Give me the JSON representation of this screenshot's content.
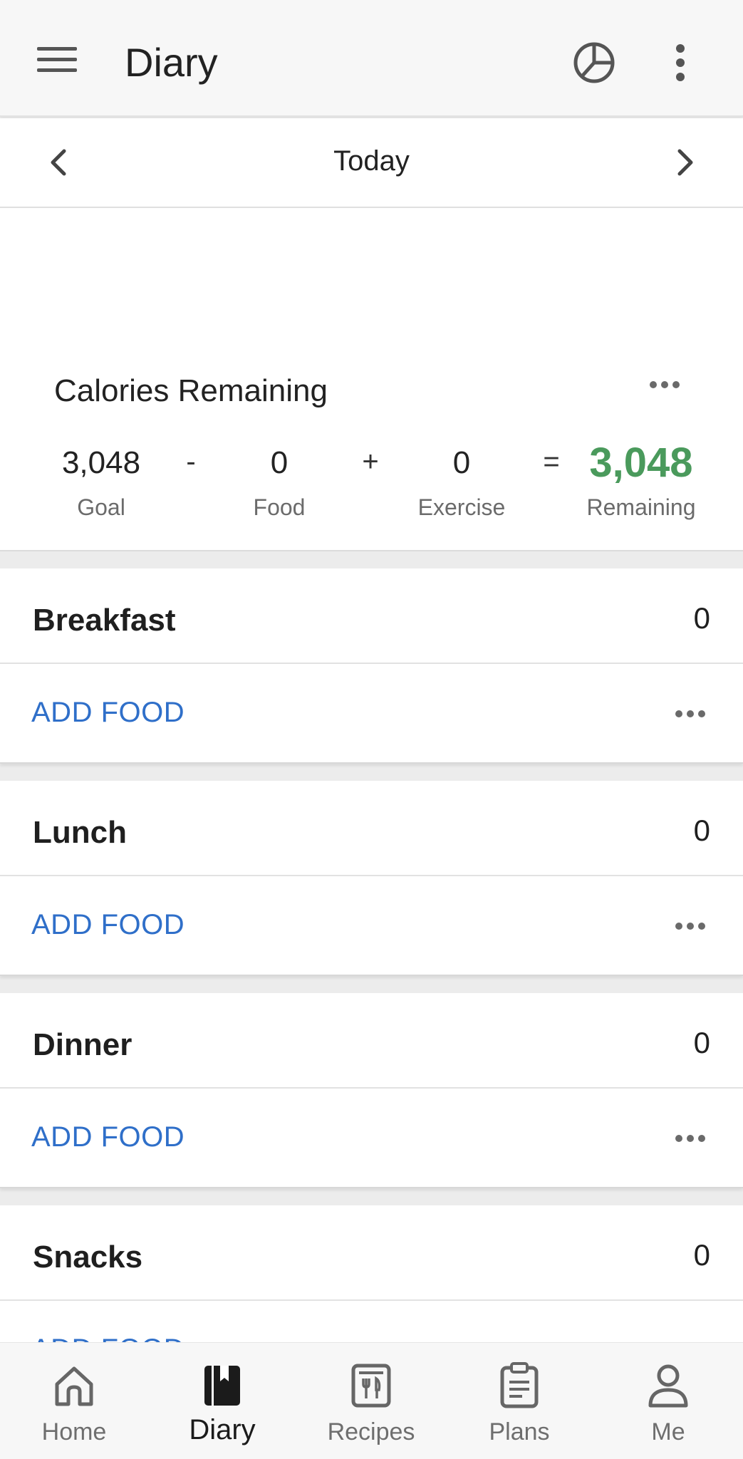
{
  "app_bar": {
    "title": "Diary",
    "menu_icon": "hamburger-menu-icon",
    "chart_icon": "pie-chart-icon",
    "more_icon": "vertical-dots-icon"
  },
  "date_nav": {
    "label": "Today",
    "prev_icon": "chevron-left-icon",
    "next_icon": "chevron-right-icon"
  },
  "calories": {
    "title": "Calories Remaining",
    "goal_value": "3,048",
    "goal_label": "Goal",
    "minus": "-",
    "food_value": "0",
    "food_label": "Food",
    "plus": "+",
    "exercise_value": "0",
    "exercise_label": "Exercise",
    "equals": "=",
    "remaining_value": "3,048",
    "remaining_label": "Remaining",
    "remaining_color": "#4a9a5c"
  },
  "meals": [
    {
      "name": "Breakfast",
      "calories": "0",
      "add_label": "ADD FOOD"
    },
    {
      "name": "Lunch",
      "calories": "0",
      "add_label": "ADD FOOD"
    },
    {
      "name": "Dinner",
      "calories": "0",
      "add_label": "ADD FOOD"
    },
    {
      "name": "Snacks",
      "calories": "0",
      "add_label": "ADD FOOD"
    }
  ],
  "bottom_nav": {
    "items": [
      {
        "label": "Home",
        "icon": "home-icon"
      },
      {
        "label": "Diary",
        "icon": "diary-book-icon",
        "active": true
      },
      {
        "label": "Recipes",
        "icon": "recipes-icon"
      },
      {
        "label": "Plans",
        "icon": "clipboard-icon"
      },
      {
        "label": "Me",
        "icon": "person-icon"
      }
    ]
  },
  "colors": {
    "accent_link": "#2f6fc9",
    "remaining_green": "#4a9a5c"
  }
}
